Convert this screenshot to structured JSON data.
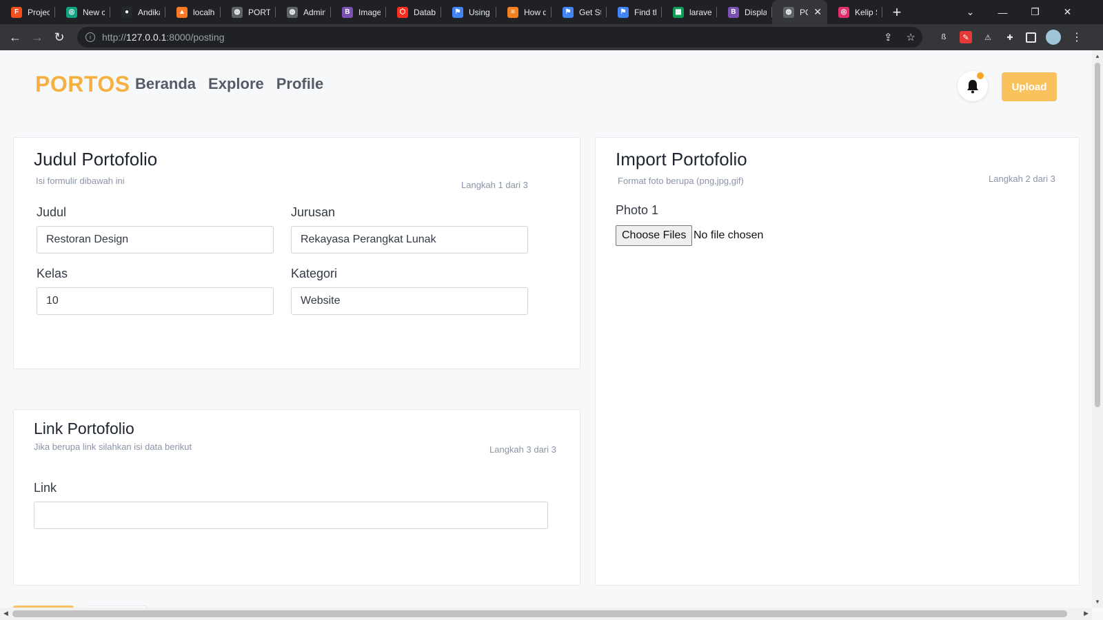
{
  "browser": {
    "tabs": [
      {
        "label": "Project",
        "icon": "figma-icon",
        "color": "#f24e1e",
        "glyph": "F"
      },
      {
        "label": "New ch",
        "icon": "chatgpt-icon",
        "color": "#10a37f",
        "glyph": "◎"
      },
      {
        "label": "Andika",
        "icon": "github-icon",
        "color": "#24292e",
        "glyph": "●"
      },
      {
        "label": "localho",
        "icon": "xampp-icon",
        "color": "#fb7a24",
        "glyph": "▲"
      },
      {
        "label": "PORTO",
        "icon": "globe-icon",
        "color": "#5f6368",
        "glyph": "◍"
      },
      {
        "label": "Admin",
        "icon": "globe-icon",
        "color": "#5f6368",
        "glyph": "◍"
      },
      {
        "label": "Images",
        "icon": "bootstrap-icon",
        "color": "#7952b3",
        "glyph": "B"
      },
      {
        "label": "Databa",
        "icon": "laravel-icon",
        "color": "#ff2d20",
        "glyph": "⬡"
      },
      {
        "label": "Using L",
        "icon": "flag-icon",
        "color": "#4285f4",
        "glyph": "⚑"
      },
      {
        "label": "How dc",
        "icon": "stackoverflow-icon",
        "color": "#f48024",
        "glyph": "≡"
      },
      {
        "label": "Get Sta",
        "icon": "flag-icon",
        "color": "#4285f4",
        "glyph": "⚑"
      },
      {
        "label": "Find th",
        "icon": "flag-icon",
        "color": "#4285f4",
        "glyph": "⚑"
      },
      {
        "label": "laravel",
        "icon": "sheets-icon",
        "color": "#0f9d58",
        "glyph": "▦"
      },
      {
        "label": "Display",
        "icon": "bootstrap-icon",
        "color": "#7952b3",
        "glyph": "B"
      },
      {
        "label": "POI",
        "icon": "globe-icon",
        "color": "#5f6368",
        "glyph": "◍",
        "active": true
      },
      {
        "label": "Kelip S",
        "icon": "instagram-icon",
        "color": "#e1306c",
        "glyph": "◎"
      }
    ],
    "new_tab": "+",
    "close_tab": "✕",
    "url_prefix": "http://",
    "url_host": "127.0.0.1",
    "url_rest": ":8000/posting"
  },
  "navbar": {
    "brand": "PORTOS",
    "links": [
      "Beranda",
      "Explore",
      "Profile"
    ],
    "upload_label": "Upload"
  },
  "card_judul": {
    "title": "Judul Portofolio",
    "subtitle": "Isi formulir dibawah ini",
    "step": "Langkah 1 dari 3",
    "judul_label": "Judul",
    "judul_value": "Restoran Design",
    "jurusan_label": "Jurusan",
    "jurusan_value": "Rekayasa Perangkat Lunak",
    "kelas_label": "Kelas",
    "kelas_value": "10",
    "kategori_label": "Kategori",
    "kategori_value": "Website"
  },
  "card_import": {
    "title": "Import Portofolio",
    "subtitle": "Format foto berupa (png,jpg,gif)",
    "step": "Langkah 2 dari 3",
    "photo_label": "Photo 1",
    "choose_files": "Choose Files",
    "file_status": "No file chosen"
  },
  "card_link": {
    "title": "Link Portofolio",
    "subtitle": "Jika berupa link silahkan isi data berikut",
    "step": "Langkah 3 dari 3",
    "link_label": "Link",
    "link_value": ""
  },
  "colors": {
    "brand": "#f5b041",
    "upload_button": "#f9c25c",
    "notification_dot": "#f5a623"
  }
}
